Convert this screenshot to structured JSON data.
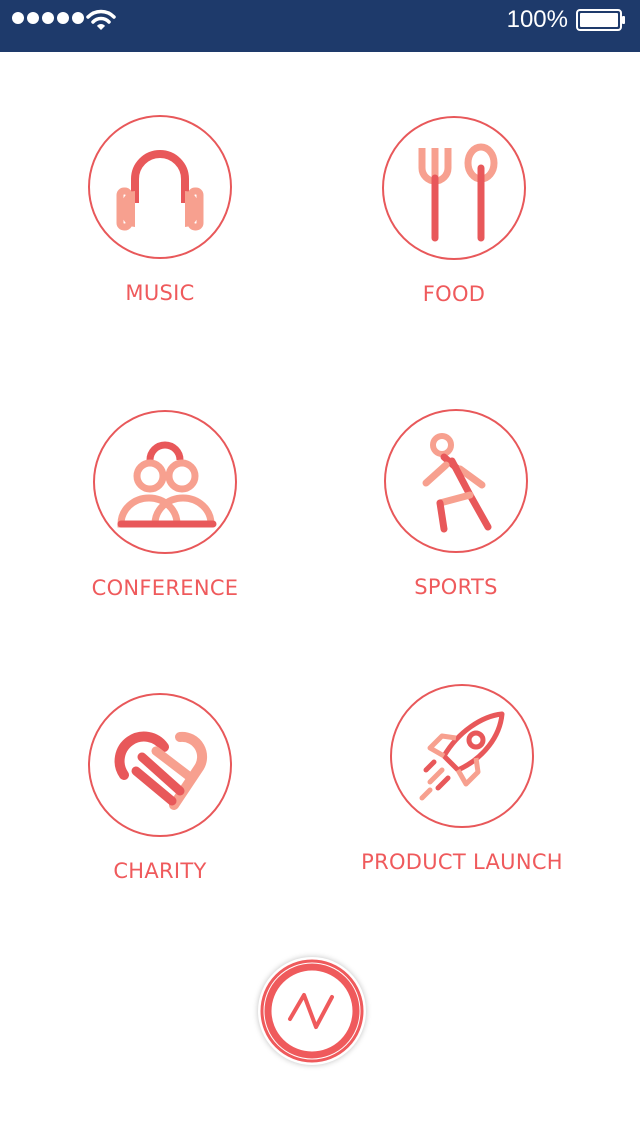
{
  "status_bar": {
    "battery_percent": "100%",
    "signal_dots": 5,
    "icons": [
      "signal-dots-icon",
      "wifi-icon",
      "battery-icon"
    ]
  },
  "categories": [
    {
      "label": "MUSIC",
      "icon": "headphones-icon"
    },
    {
      "label": "FOOD",
      "icon": "fork-spoon-icon"
    },
    {
      "label": "CONFERENCE",
      "icon": "people-group-icon"
    },
    {
      "label": "SPORTS",
      "icon": "walking-person-icon"
    },
    {
      "label": "CHARITY",
      "icon": "heart-hands-icon"
    },
    {
      "label": "PRODUCT LAUNCH",
      "icon": "rocket-icon"
    }
  ],
  "logo": {
    "icon": "brand-logo-icon"
  },
  "colors": {
    "accent": "#ef5a5c",
    "accent_light": "#f7a08f",
    "status_bar": "#1e3a6b",
    "background": "#ffffff"
  }
}
